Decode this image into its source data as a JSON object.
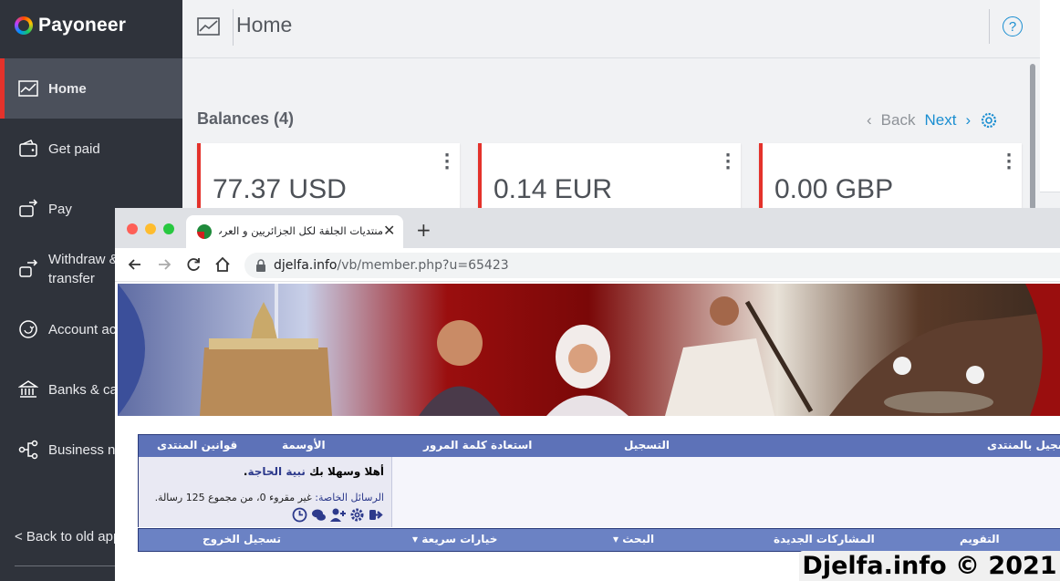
{
  "payoneer": {
    "brand": "Payoneer",
    "nav": [
      {
        "label": "Home",
        "icon": "chart-icon",
        "active": true
      },
      {
        "label": "Get paid",
        "icon": "wallet-icon",
        "active": false
      },
      {
        "label": "Pay",
        "icon": "pay-icon",
        "active": false
      },
      {
        "label": "Withdraw &\ntransfer",
        "icon": "transfer-icon",
        "active": false
      },
      {
        "label": "Account ac",
        "icon": "account-icon",
        "active": false
      },
      {
        "label": "Banks & ca",
        "icon": "bank-icon",
        "active": false
      },
      {
        "label": "Business n",
        "icon": "network-icon",
        "active": false
      }
    ],
    "back_old": "< Back to old app",
    "header_title": "Home",
    "help": "?",
    "balances_title": "Balances (4)",
    "pager": {
      "back": "Back",
      "next": "Next"
    },
    "balances": [
      {
        "amount": "77.37 USD"
      },
      {
        "amount": "0.14 EUR"
      },
      {
        "amount": "0.00 GBP"
      }
    ],
    "colors": {
      "sidebar": "#2f333b",
      "accent": "#e4322b",
      "link": "#1a8ed1"
    }
  },
  "browser": {
    "tab_title": "منتديات الجلفة لكل الجزائريين و العرب -",
    "url_host": "djelfa.info",
    "url_path": "/vb/member.php?u=65423"
  },
  "forum": {
    "top_nav": [
      "تسجيل بالمنتدى",
      "التسجيل",
      "استعادة كلمة المرور",
      "الأوسمة",
      "قوانين المنتدى"
    ],
    "welcome_prefix": "أهلا وسهلا بك",
    "username": "نبية الحاجة",
    "pm_label": "الرسائل الخاصة:",
    "pm_text": "غير مقروء 0، من مجموع 125 رسالة.",
    "bottom_nav": [
      "التقويم",
      "المشاركات الجديدة",
      "البحث",
      "خيارات سريعة",
      "تسجيل الخروج"
    ]
  },
  "watermark": "Djelfa.info © 2021"
}
